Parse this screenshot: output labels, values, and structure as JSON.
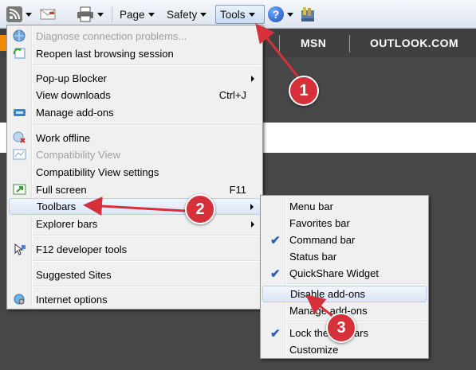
{
  "command_bar": {
    "page_label": "Page",
    "safety_label": "Safety",
    "tools_label": "Tools"
  },
  "site_nav": {
    "links": [
      "MSN",
      "OUTLOOK.COM"
    ],
    "partial_letter": "B"
  },
  "tools_menu": {
    "items": [
      {
        "label": "Diagnose connection problems...",
        "disabled": true,
        "icon": "diagnose-icon"
      },
      {
        "label": "Reopen last browsing session",
        "icon": "reopen-icon"
      },
      {
        "label": "Pop-up Blocker",
        "submenu": true
      },
      {
        "label": "View downloads",
        "shortcut": "Ctrl+J"
      },
      {
        "label": "Manage add-ons",
        "icon": "addons-icon"
      },
      {
        "label": "Work offline",
        "icon": "work-offline-icon"
      },
      {
        "label": "Compatibility View",
        "disabled": true,
        "icon": "compat-view-icon"
      },
      {
        "label": "Compatibility View settings"
      },
      {
        "label": "Full screen",
        "shortcut": "F11",
        "icon": "fullscreen-icon"
      },
      {
        "label": "Toolbars",
        "submenu": true,
        "highlighted": true
      },
      {
        "label": "Explorer bars",
        "submenu": true
      },
      {
        "label": "F12 developer tools",
        "icon": "dev-tools-icon"
      },
      {
        "label": "Suggested Sites"
      },
      {
        "label": "Internet options",
        "icon": "internet-options-icon"
      }
    ]
  },
  "toolbars_submenu": {
    "items": [
      {
        "label": "Menu bar",
        "checked": false
      },
      {
        "label": "Favorites bar",
        "checked": false
      },
      {
        "label": "Command bar",
        "checked": true
      },
      {
        "label": "Status bar",
        "checked": false
      },
      {
        "label": "QuickShare Widget",
        "checked": true
      },
      {
        "label": "Disable add-ons",
        "checked": false,
        "highlighted": true
      },
      {
        "label": "Manage add-ons",
        "checked": false
      },
      {
        "label": "Lock the toolbars",
        "checked": true
      },
      {
        "label": "Customize",
        "checked": false
      }
    ]
  },
  "callouts": [
    "1",
    "2",
    "3"
  ],
  "colors": {
    "callout": "#d6313a",
    "menu_bg": "#f0f0f0",
    "highlight": "#dbe6f7",
    "page_bg": "#474747",
    "accent_orange": "#f08a00"
  }
}
